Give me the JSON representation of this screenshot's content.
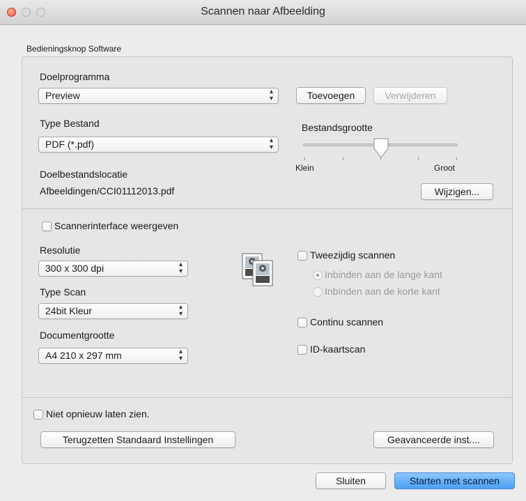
{
  "window": {
    "title": "Scannen naar Afbeelding"
  },
  "group_title": "Bedieningsknop Software",
  "target": {
    "label": "Doelprogramma",
    "selected": "Preview",
    "add_button": "Toevoegen",
    "remove_button": "Verwijderen"
  },
  "file_type": {
    "label": "Type Bestand",
    "selected": "PDF (*.pdf)"
  },
  "file_size": {
    "label": "Bestandsgrootte",
    "min_label": "Klein",
    "max_label": "Groot",
    "value_fraction": 0.5
  },
  "destination": {
    "label": "Doelbestandslocatie",
    "path": "Afbeeldingen/CCI01112013.pdf",
    "change_button": "Wijzigen..."
  },
  "scanner_interface": {
    "label": "Scannerinterface weergeven",
    "checked": false
  },
  "resolution": {
    "label": "Resolutie",
    "selected": "300 x 300 dpi"
  },
  "scan_type": {
    "label": "Type Scan",
    "selected": "24bit Kleur"
  },
  "document_size": {
    "label": "Documentgrootte",
    "selected": "A4 210 x 297 mm"
  },
  "duplex": {
    "label": "Tweezijdig scannen",
    "checked": false,
    "options": [
      "Inbinden aan de lange kant",
      "Inbinden aan de korte kant"
    ],
    "selected_index": 0
  },
  "continuous": {
    "label": "Continu scannen",
    "checked": false
  },
  "id_card": {
    "label": "ID-kaartscan",
    "checked": false
  },
  "dont_show": {
    "label": "Niet opnieuw laten zien.",
    "checked": false
  },
  "reset_button": "Terugzetten Standaard Instellingen",
  "advanced_button": "Geavanceerde inst....",
  "close_button": "Sluiten",
  "start_button": "Starten met scannen"
}
